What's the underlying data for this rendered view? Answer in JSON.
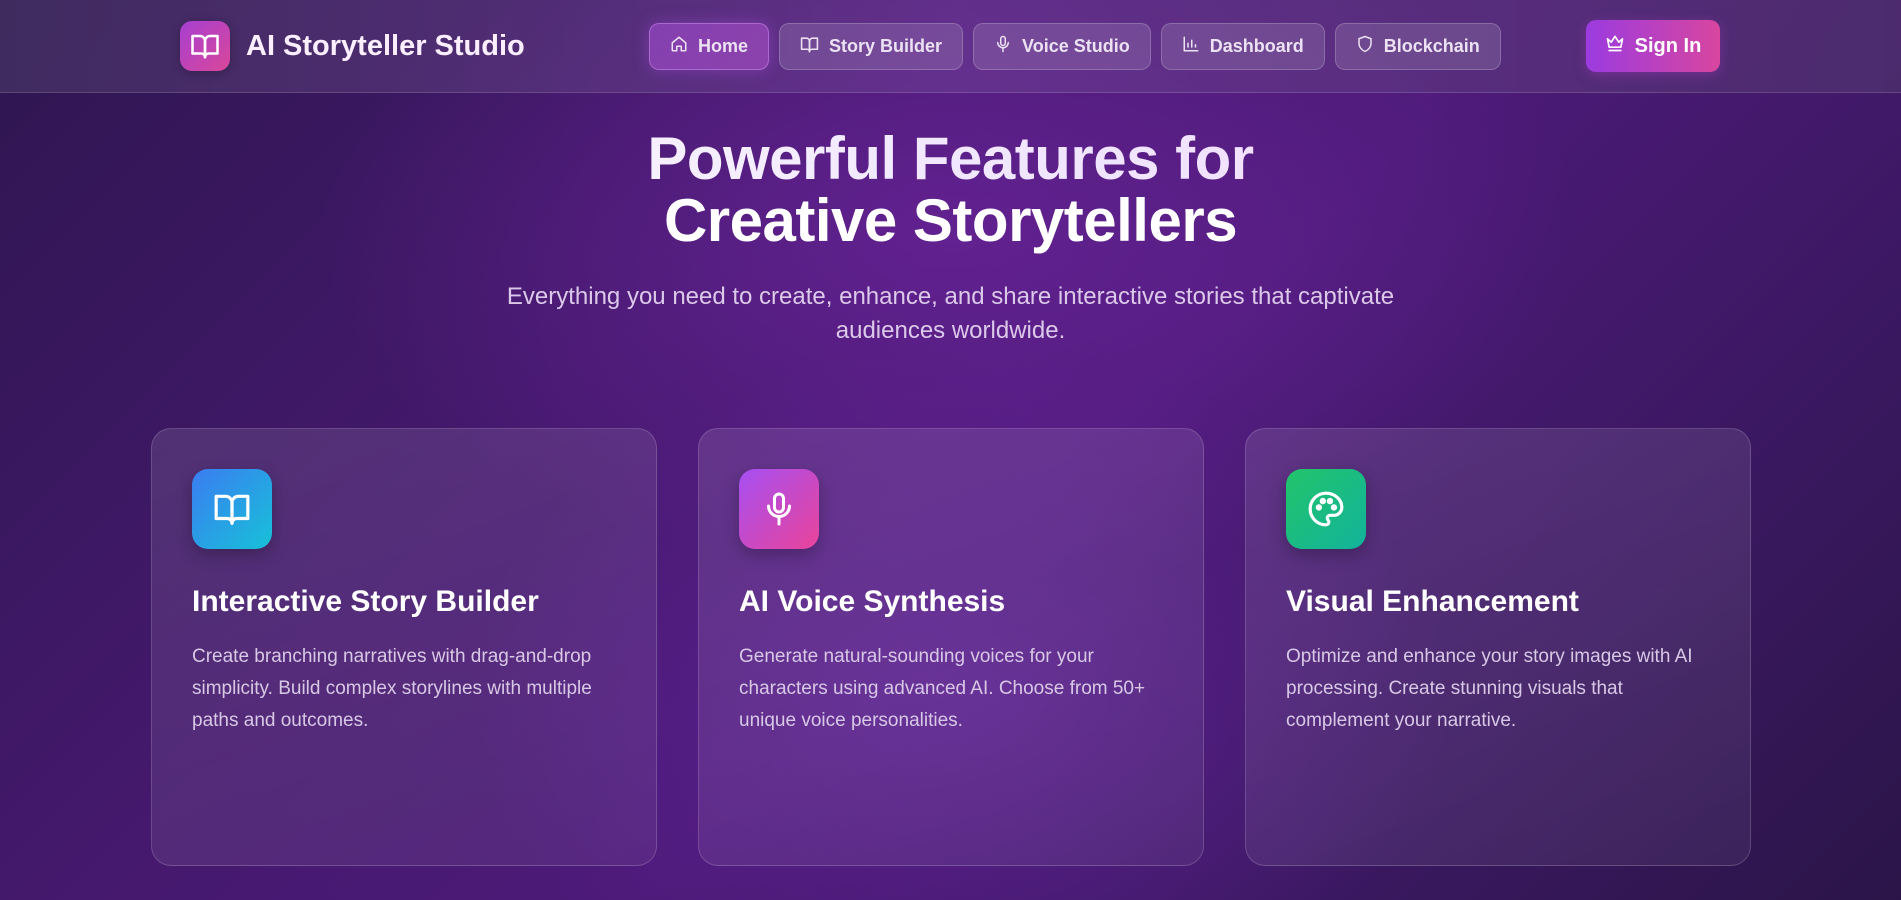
{
  "brand": {
    "title": "AI Storyteller Studio",
    "icon": "book-open-icon"
  },
  "nav": {
    "items": [
      {
        "label": "Home",
        "icon": "home-icon",
        "active": true
      },
      {
        "label": "Story Builder",
        "icon": "book-open-icon",
        "active": false
      },
      {
        "label": "Voice Studio",
        "icon": "microphone-icon",
        "active": false
      },
      {
        "label": "Dashboard",
        "icon": "bar-chart-icon",
        "active": false
      },
      {
        "label": "Blockchain",
        "icon": "shield-icon",
        "active": false
      }
    ],
    "sign_in": {
      "label": "Sign In",
      "icon": "crown-icon"
    }
  },
  "hero": {
    "title_line1": "Powerful Features for",
    "title_line2": "Creative Storytellers",
    "subtitle": "Everything you need to create, enhance, and share interactive stories that captivate audiences worldwide."
  },
  "features": [
    {
      "title": "Interactive Story Builder",
      "description": "Create branching narratives with drag-and-drop simplicity. Build complex storylines with multiple paths and outcomes.",
      "icon": "book-open-icon",
      "color": "#2f8ff0"
    },
    {
      "title": "AI Voice Synthesis",
      "description": "Generate natural-sounding voices for your characters using advanced AI. Choose from 50+ unique voice personalities.",
      "icon": "microphone-icon",
      "color": "#d647b8"
    },
    {
      "title": "Visual Enhancement",
      "description": "Optimize and enhance your story images with AI processing. Create stunning visuals that complement your narrative.",
      "icon": "palette-icon",
      "color": "#1dbd82"
    }
  ]
}
